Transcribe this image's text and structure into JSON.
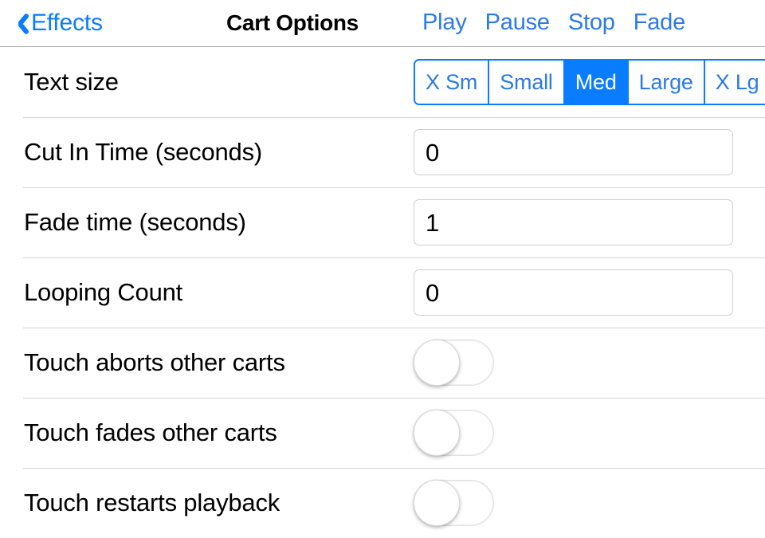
{
  "navbar": {
    "back_icon": "chevron-left-icon",
    "back_label": "Effects",
    "title": "Cart Options",
    "actions": [
      {
        "label": "Play"
      },
      {
        "label": "Pause"
      },
      {
        "label": "Stop"
      },
      {
        "label": "Fade"
      }
    ]
  },
  "colors": {
    "accent_blue": "#0a7cff",
    "action_blue": "#2a7ae8",
    "separator": "#d4d4d4",
    "navbar_border": "#a9a9a9",
    "field_border": "#cfcfcf"
  },
  "rows": [
    {
      "label": "Text size",
      "control": "segmented",
      "segments": [
        {
          "label": "X Sm",
          "selected": false
        },
        {
          "label": "Small",
          "selected": false
        },
        {
          "label": "Med",
          "selected": true
        },
        {
          "label": "Large",
          "selected": false
        },
        {
          "label": "X Lg",
          "selected": false
        }
      ],
      "selected_value": "Med"
    },
    {
      "label": "Cut In Time (seconds)",
      "control": "textfield",
      "value": "0",
      "placeholder": ""
    },
    {
      "label": "Fade time (seconds)",
      "control": "textfield",
      "value": "1",
      "placeholder": ""
    },
    {
      "label": "Looping Count",
      "control": "textfield",
      "value": "0",
      "placeholder": ""
    },
    {
      "label": "Touch aborts other carts",
      "control": "switch",
      "value": "off"
    },
    {
      "label": "Touch fades other carts",
      "control": "switch",
      "value": "off"
    },
    {
      "label": "Touch restarts playback",
      "control": "switch",
      "value": "off"
    }
  ]
}
